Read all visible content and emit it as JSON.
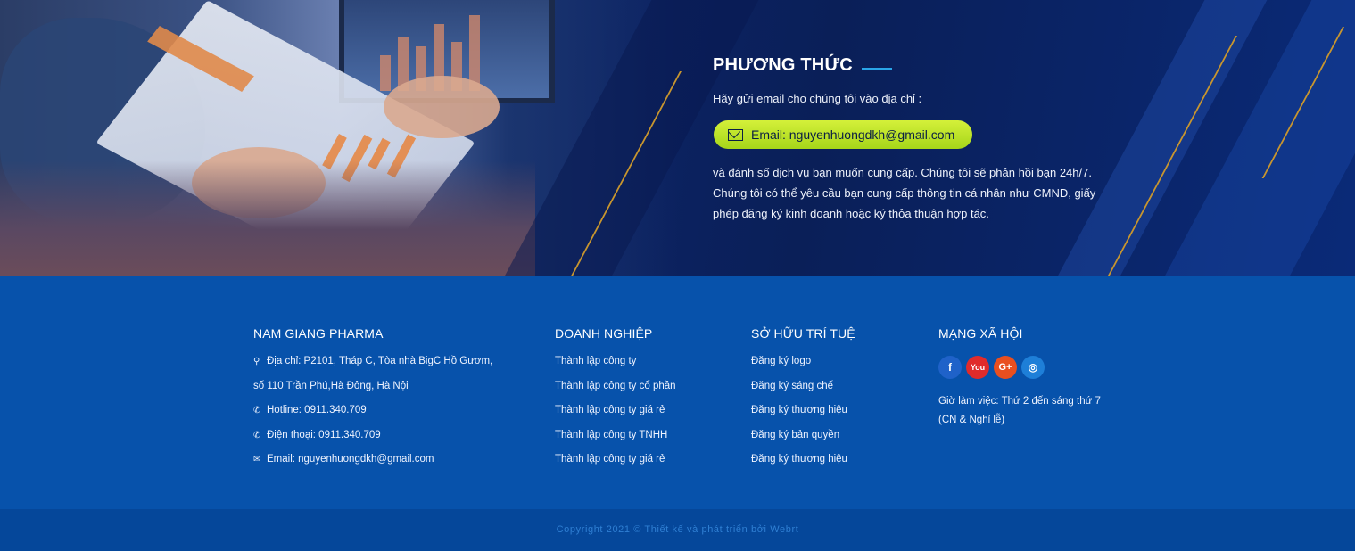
{
  "hero": {
    "title": "PHƯƠNG THỨC",
    "intro": "Hãy gửi email cho chúng tôi vào địa chỉ :",
    "email_button": "Email: nguyenhuongdkh@gmail.com",
    "body": "và đánh số dịch vụ bạn muốn cung cấp. Chúng tôi sẽ phản hồi bạn 24h/7. Chúng tôi có thể yêu cầu bạn cung cấp thông tin cá nhân như CMND, giấy phép đăng ký kinh doanh hoặc ký thỏa thuận hợp tác."
  },
  "footer": {
    "company": {
      "heading": "NAM GIANG PHARMA",
      "address_line1": "Địa chỉ: P2101, Tháp C, Tòa nhà BigC Hồ Gươm,",
      "address_line2": "số 110 Trần Phú,Hà Đông, Hà Nội",
      "hotline": "Hotline: 0911.340.709",
      "phone": "Điện thoại: 0911.340.709",
      "email": "Email: nguyenhuongdkh@gmail.com"
    },
    "business": {
      "heading": "DOANH NGHIỆP",
      "links": [
        "Thành lập công ty",
        "Thành lập công ty cổ phần",
        "Thành lập công ty giá rẻ",
        "Thành lập công ty TNHH",
        "Thành lập công ty giá rẻ"
      ]
    },
    "ip": {
      "heading": "SỞ HỮU TRÍ TUỆ",
      "links": [
        "Đăng ký logo",
        "Đăng ký sáng chế",
        "Đăng ký thương hiệu",
        "Đăng ký bản quyền",
        "Đăng ký thương hiệu"
      ]
    },
    "social": {
      "heading": "MẠNG XÃ HỘI",
      "icons": [
        {
          "name": "facebook-icon",
          "glyph": "f",
          "color": "#1f62c9"
        },
        {
          "name": "youtube-icon",
          "glyph": "You",
          "color": "#e02b2b"
        },
        {
          "name": "google-plus-icon",
          "glyph": "G+",
          "color": "#e94f1f"
        },
        {
          "name": "instagram-icon",
          "glyph": "◎",
          "color": "#1e7fd8"
        }
      ],
      "hours": "Giờ làm việc: Thứ 2 đến sáng thứ 7 (CN & Nghỉ lễ)"
    }
  },
  "copyright": "Copyright 2021 © Thiết kế và phát triển bởi Webrt",
  "colors": {
    "accent": "#b9e32a",
    "footer_bg": "#0752ab",
    "title_line": "#2aa6e8"
  }
}
